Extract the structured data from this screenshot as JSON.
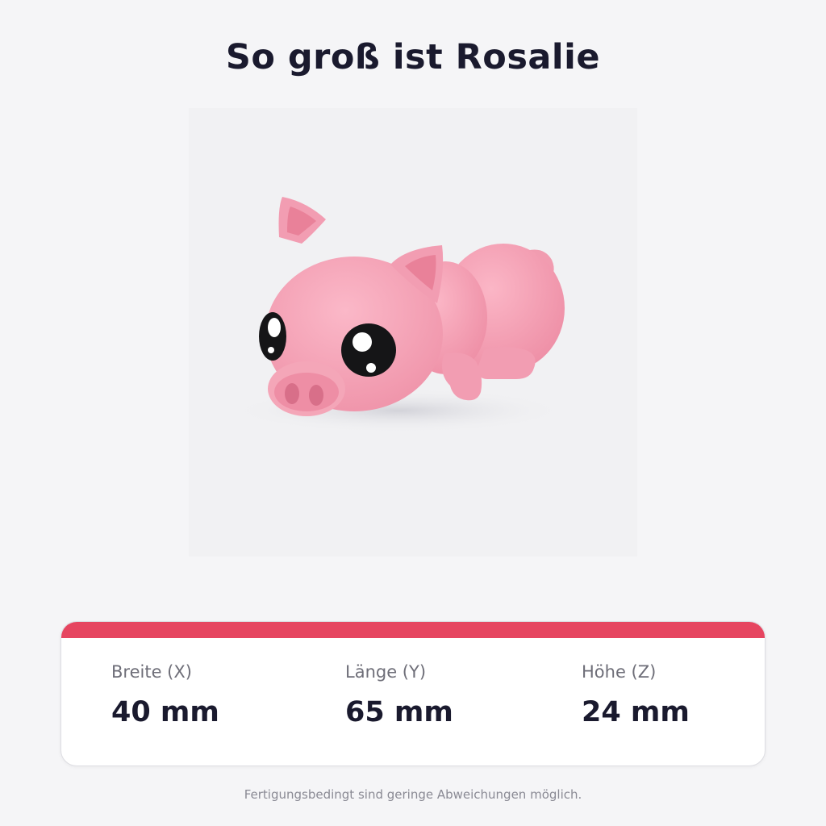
{
  "title": "So groß ist Rosalie",
  "image": {
    "subject": "pink pig figure"
  },
  "colors": {
    "accent": "#e64560",
    "pig": "#f4a0b4",
    "text": "#1a1a2e"
  },
  "dimensions": [
    {
      "label": "Breite (X)",
      "value": "40 mm"
    },
    {
      "label": "Länge (Y)",
      "value": "65 mm"
    },
    {
      "label": "Höhe (Z)",
      "value": "24 mm"
    }
  ],
  "footnote": "Fertigungsbedingt sind geringe Abweichungen möglich."
}
